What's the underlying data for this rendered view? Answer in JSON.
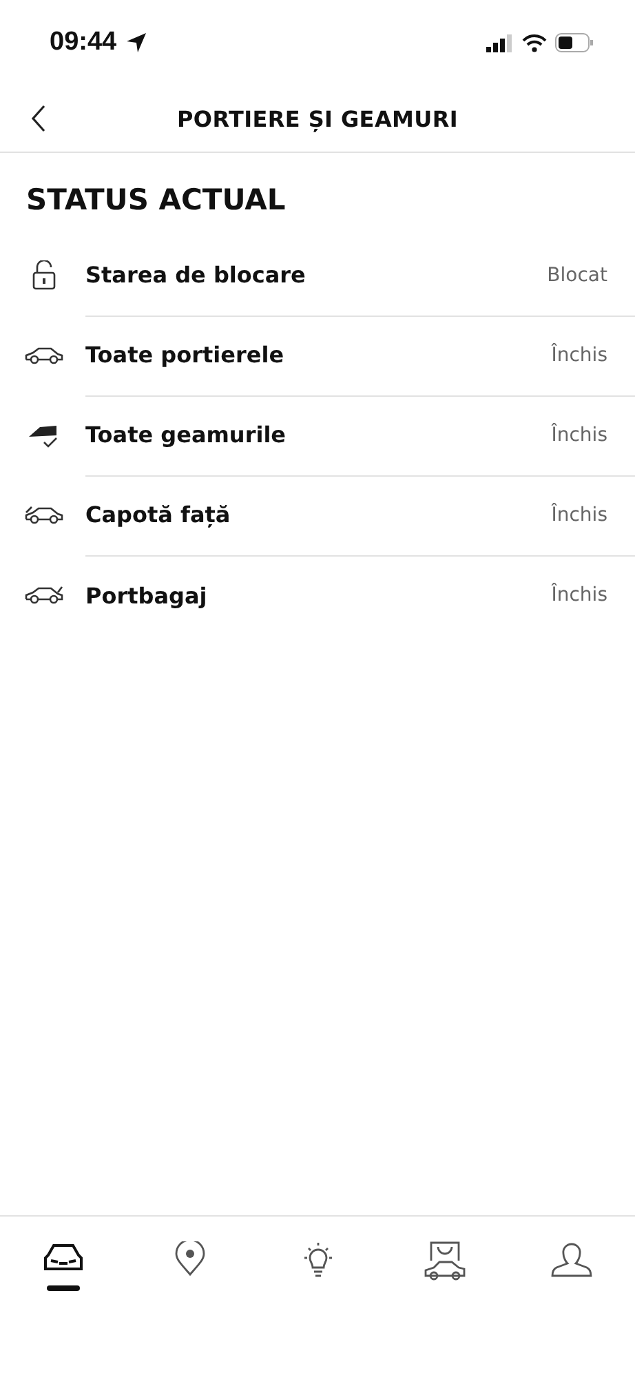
{
  "status_bar": {
    "time": "09:44"
  },
  "header": {
    "title": "PORTIERE ȘI GEAMURI"
  },
  "section": {
    "title": "STATUS ACTUAL"
  },
  "rows": [
    {
      "kind": "lock",
      "label": "Starea de blocare",
      "value": "Blocat"
    },
    {
      "kind": "doors",
      "label": "Toate portierele",
      "value": "Închis"
    },
    {
      "kind": "windows",
      "label": "Toate geamurile",
      "value": "Închis"
    },
    {
      "kind": "hood",
      "label": "Capotă față",
      "value": "Închis"
    },
    {
      "kind": "trunk",
      "label": "Portbagaj",
      "value": "Închis"
    }
  ],
  "tab_bar": [
    {
      "kind": "car",
      "selected": true
    },
    {
      "kind": "map",
      "selected": false
    },
    {
      "kind": "idea",
      "selected": false
    },
    {
      "kind": "shop",
      "selected": false
    },
    {
      "kind": "profile",
      "selected": false
    }
  ]
}
